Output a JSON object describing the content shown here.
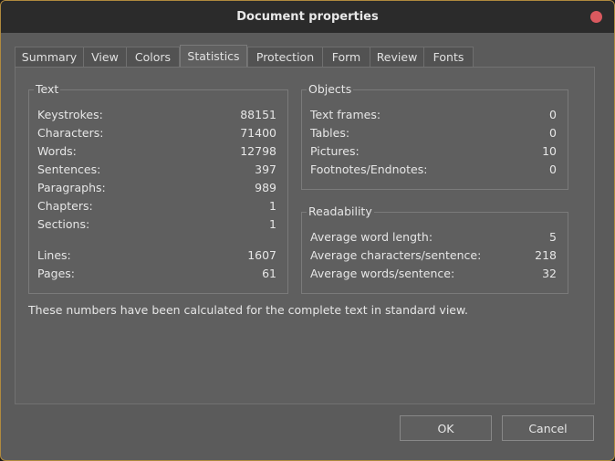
{
  "window": {
    "title": "Document properties"
  },
  "tabs": [
    {
      "label": "Summary"
    },
    {
      "label": "View"
    },
    {
      "label": "Colors"
    },
    {
      "label": "Statistics"
    },
    {
      "label": "Protection"
    },
    {
      "label": "Form"
    },
    {
      "label": "Review"
    },
    {
      "label": "Fonts"
    }
  ],
  "active_tab": "Statistics",
  "text_group": {
    "title": "Text",
    "rows": [
      {
        "label": "Keystrokes:",
        "value": "88151"
      },
      {
        "label": "Characters:",
        "value": "71400"
      },
      {
        "label": "Words:",
        "value": "12798"
      },
      {
        "label": "Sentences:",
        "value": "397"
      },
      {
        "label": "Paragraphs:",
        "value": "989"
      },
      {
        "label": "Chapters:",
        "value": "1"
      },
      {
        "label": "Sections:",
        "value": "1"
      },
      {
        "label": "Lines:",
        "value": "1607"
      },
      {
        "label": "Pages:",
        "value": "61"
      }
    ]
  },
  "objects_group": {
    "title": "Objects",
    "rows": [
      {
        "label": "Text frames:",
        "value": "0"
      },
      {
        "label": "Tables:",
        "value": "0"
      },
      {
        "label": "Pictures:",
        "value": "10"
      },
      {
        "label": "Footnotes/Endnotes:",
        "value": "0"
      }
    ]
  },
  "readability_group": {
    "title": "Readability",
    "rows": [
      {
        "label": "Average word length:",
        "value": "5"
      },
      {
        "label": "Average characters/sentence:",
        "value": "218"
      },
      {
        "label": "Average words/sentence:",
        "value": "32"
      }
    ]
  },
  "note": "These numbers have been calculated for the complete text in standard view.",
  "buttons": {
    "ok": "OK",
    "cancel": "Cancel"
  },
  "colors": {
    "close_button": "#d9595f",
    "window_border": "#b08a3e"
  }
}
